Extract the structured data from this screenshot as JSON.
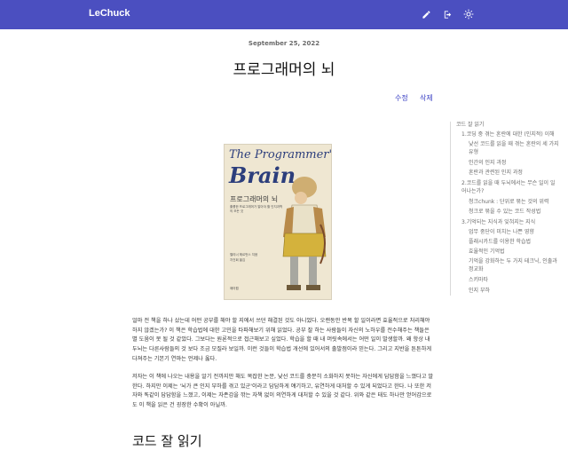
{
  "app": {
    "brand": "LeChuck"
  },
  "toolbar": {
    "edit_icon": "pencil-icon",
    "logout_icon": "logout-icon",
    "theme_icon": "sun-icon"
  },
  "post": {
    "date": "September 25, 2022",
    "title": "프로그래머의 뇌",
    "edit_label": "수정",
    "delete_label": "삭제",
    "body": [
      "얼마 전 책을 하나 샀는데 어떤 공부를 해야 할 지에서 쓰던 해결된 것도 아니었다. 오랜동안 반복 할 일이라면 효율적으로 처리해야 하지 않겠는가? 이 책은 학습법에 대한 고민을 타파해보기 위해 읽었다. 공부 잘 하는 사람들이 자신의 노하우를 전수해주는 책들은 별 도움이 못 될 것 같았다. 그보다는 원론적으로 접근해보고 싶었다. 학습을 할 때 내 머릿속에서는 어떤 일이 발생할까. 왜 항상 내 두뇌는 다른사람들의 것 보다 조금 모질라 보일까. 이런 것들이 학습법 개선에 있어서의 출발점이라 믿는다. 그리고 지반을 튼튼하게 다져주는 기본기 연마는 언제나 옳다.",
      "저자는 이 책에 나오는 내용을 알기 전까지만 해도 복잡한 논문, 낯선 코드를 충분히 소화하지 못하는 자신에게 답답함을 느꼈다고 말한다. 하지만 이제는 '뇌가 큰 인지 부하를 겪고 있군'이라고 담담하게 얘기하고, 유연하게 대처할 수 있게 되었다고 한다. 나 또한 저자와 똑같이 답답함을 느꼈고, 이제는 자존감을 깎는 자책 없이 의연하게 대처할 수 있을 것 같다. 위와 같은 태도 하나만 얻어감으로도 이 책을 읽은 건 굉장한 수확이 아닐까."
    ],
    "heading": "코드 잘 읽기"
  },
  "book_cover": {
    "title_line1": "The Programmer's",
    "title_line2": "Brain",
    "korean_title": "프로그래머의 뇌",
    "subtitle": "훌륭한 프로그래머가 알아야 할 인지과학의 모든 것",
    "author": "펠리너 헤르먼스 지음",
    "translator": "차건회 옮김",
    "publisher": "제이펍"
  },
  "toc": [
    {
      "label": "코드 잘 읽기",
      "level": 0
    },
    {
      "label": "1.코딩 중 겪는 혼란에 대한 (인지적) 이해",
      "level": 1
    },
    {
      "label": "낯선 코드를 읽을 때 겪는 혼란의 세 가지",
      "level": 2
    },
    {
      "label": "유형",
      "level": 2
    },
    {
      "label": "인간의 인지 과정",
      "level": 2
    },
    {
      "label": "혼란과 관련된 인지 과정",
      "level": 2
    },
    {
      "label": "2.코드를 읽을 때 두뇌에서는 무슨 일이 일",
      "level": 1
    },
    {
      "label": "어나는가?",
      "level": 1
    },
    {
      "label": "청크chunk : 단위로 묶는 것의 위력",
      "level": 2
    },
    {
      "label": "청크로 묶을 수 있는 코드 작성법",
      "level": 2
    },
    {
      "label": "3.기억되는 지식과 잊혀지는 지식",
      "level": 1
    },
    {
      "label": "업무 중단이 미치는 나쁜 영향",
      "level": 2
    },
    {
      "label": "플래시카드를 이용한 학습법",
      "level": 2
    },
    {
      "label": "효율적인 기억법",
      "level": 2
    },
    {
      "label": "기억을 강화하는 두 가지 테크닉, 인출과",
      "level": 2
    },
    {
      "label": "정교화",
      "level": 2
    },
    {
      "label": "스키마타",
      "level": 2
    },
    {
      "label": "인지 부하",
      "level": 2
    }
  ]
}
